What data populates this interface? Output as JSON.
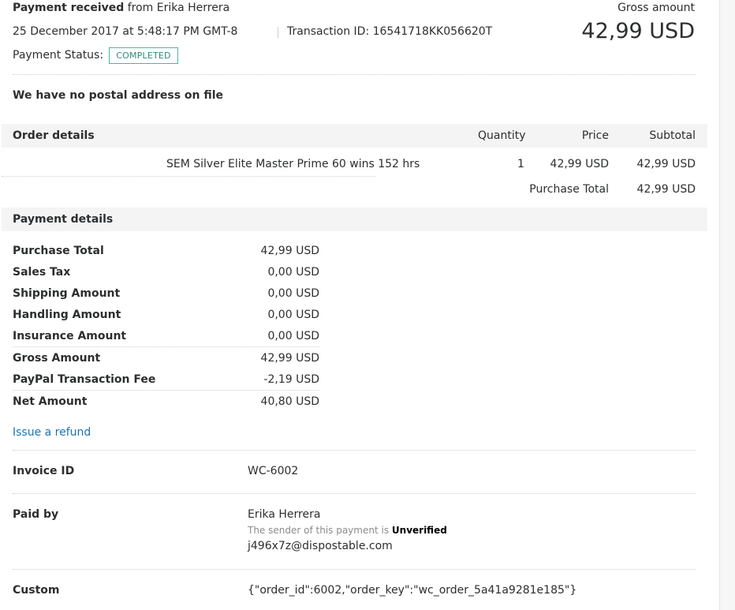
{
  "header": {
    "payment_received_label": "Payment received",
    "from_text": "from Erika Herrera",
    "datetime": "25 December 2017 at 5:48:17 PM GMT-8",
    "transaction_id": "Transaction ID: 16541718KK056620T",
    "payment_status_label": "Payment Status:",
    "payment_status_value": "COMPLETED",
    "gross_amount_label": "Gross amount",
    "gross_amount_value": "42,99 USD"
  },
  "address_notice": "We have no postal address on file",
  "order": {
    "header": {
      "title": "Order details",
      "quantity": "Quantity",
      "price": "Price",
      "subtotal": "Subtotal"
    },
    "items": [
      {
        "name": "SEM Silver Elite Master Prime 60 wins 152 hrs",
        "quantity": "1",
        "price": "42,99 USD",
        "subtotal": "42,99 USD"
      }
    ],
    "purchase_total_label": "Purchase Total",
    "purchase_total_value": "42,99 USD"
  },
  "payment_details": {
    "title": "Payment details",
    "rows": [
      {
        "label": "Purchase Total",
        "value": "42,99 USD"
      },
      {
        "label": "Sales Tax",
        "value": "0,00 USD"
      },
      {
        "label": "Shipping Amount",
        "value": "0,00 USD"
      },
      {
        "label": "Handling Amount",
        "value": "0,00 USD"
      },
      {
        "label": "Insurance Amount",
        "value": "0,00 USD"
      },
      {
        "label": "Gross Amount",
        "value": "42,99 USD"
      },
      {
        "label": "PayPal Transaction Fee",
        "value": "-2,19 USD"
      },
      {
        "label": "Net Amount",
        "value": "40,80 USD"
      }
    ],
    "refund_link": "Issue a refund"
  },
  "invoice": {
    "label": "Invoice ID",
    "value": "WC-6002"
  },
  "paid_by": {
    "label": "Paid by",
    "name": "Erika Herrera",
    "sender_note_prefix": "The sender of this payment is",
    "sender_status": "Unverified",
    "email": "j496x7z@dispostable.com"
  },
  "custom": {
    "label": "Custom",
    "value": "{\"order_id\":6002,\"order_key\":\"wc_order_5a41a9281e185\"}"
  }
}
